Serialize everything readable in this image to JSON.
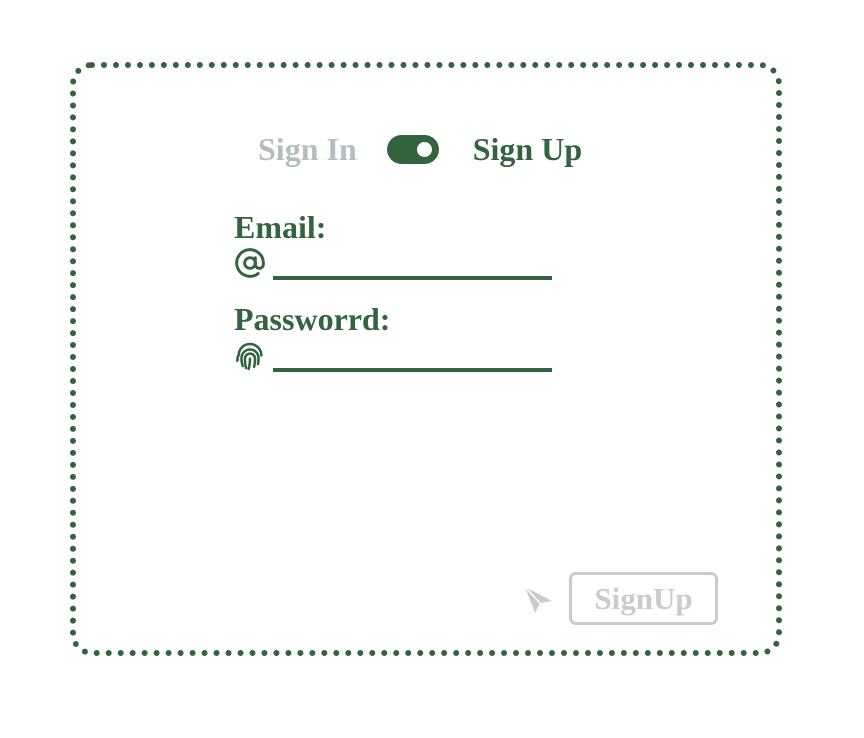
{
  "auth_toggle": {
    "sign_in_label": "Sign In",
    "sign_up_label": "Sign Up",
    "active_mode": "Sign Up"
  },
  "email": {
    "label": "Email:",
    "value": "",
    "icon": "at-sign-icon"
  },
  "password": {
    "label": "Passworrd:",
    "value": "",
    "icon": "fingerprint-icon"
  },
  "submit": {
    "label": "SignUp",
    "icon": "send-icon",
    "disabled": true
  },
  "colors": {
    "accent": "#33633f",
    "inactive_text": "#b6bdc0",
    "disabled": "#c9cbcc",
    "background": "#ffffff"
  }
}
